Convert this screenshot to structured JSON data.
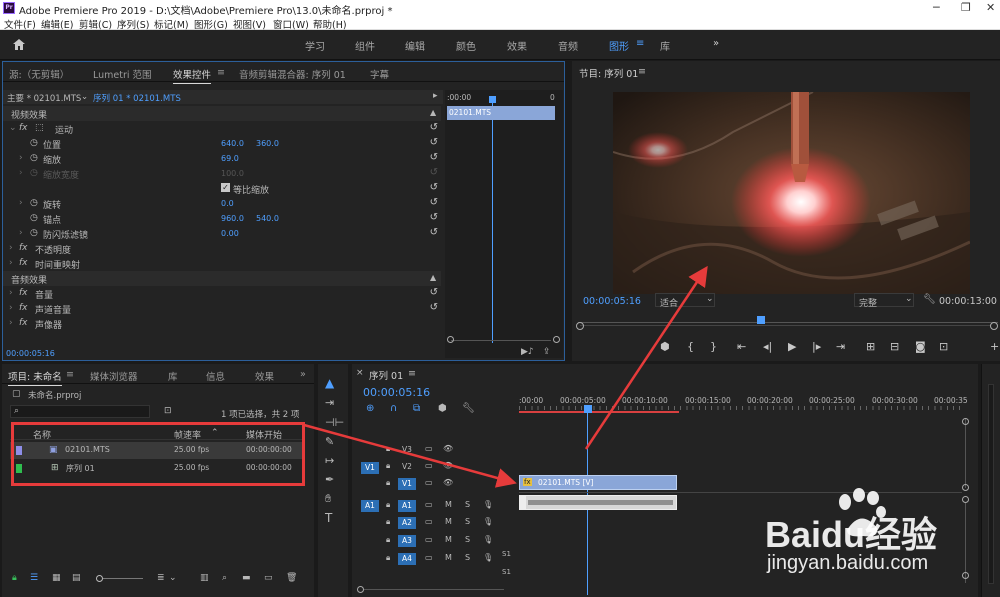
{
  "window": {
    "title": "Adobe Premiere Pro 2019 - D:\\文档\\Adobe\\Premiere Pro\\13.0\\未命名.prproj *",
    "app_icon": "Pr"
  },
  "menu": [
    "文件(F)",
    "编辑(E)",
    "剪辑(C)",
    "序列(S)",
    "标记(M)",
    "图形(G)",
    "视图(V)",
    "窗口(W)",
    "帮助(H)"
  ],
  "workspaces": [
    "学习",
    "组件",
    "编辑",
    "颜色",
    "效果",
    "音频",
    "图形",
    "库"
  ],
  "active_workspace": "图形",
  "effect_panel": {
    "tabs": [
      "源:（无剪辑）",
      "Lumetri 范围",
      "效果控件",
      "音频剪辑混合器: 序列 01",
      "字幕"
    ],
    "active_tab": "效果控件",
    "master": "主要 * 02101.MTS",
    "sequence": "序列 01 * 02101.MTS",
    "mini_time_start": ":00:00",
    "mini_time_end": "0",
    "clip_label": "02101.MTS",
    "video_effects": "视频效果",
    "motion": "运动",
    "position_label": "位置",
    "position_x": "640.0",
    "position_y": "360.0",
    "scale_label": "缩放",
    "scale": "69.0",
    "scale_width_label": "缩放宽度",
    "scale_width": "100.0",
    "uniform_scale": "等比缩放",
    "rotation_label": "旋转",
    "rotation": "0.0",
    "anchor_label": "锚点",
    "anchor_x": "960.0",
    "anchor_y": "540.0",
    "flicker_label": "防闪烁滤镜",
    "flicker": "0.00",
    "opacity": "不透明度",
    "time_remap": "时间重映射",
    "audio_effects": "音频效果",
    "volume": "音量",
    "channel_volume": "声道音量",
    "panner": "声像器",
    "timecode": "00:00:05:16"
  },
  "program": {
    "title": "节目: 序列 01",
    "timecode": "00:00:05:16",
    "fit": "适合",
    "quality": "完整",
    "duration": "00:00:13:00"
  },
  "project": {
    "tabs": [
      "项目: 未命名",
      "媒体浏览器",
      "库",
      "信息",
      "效果"
    ],
    "file": "未命名.prproj",
    "selection": "1 项已选择，共 2 项",
    "columns": [
      "名称",
      "帧速率",
      "媒体开始"
    ],
    "items": [
      {
        "name": "02101.MTS",
        "fps": "25.00 fps",
        "start": "00:00:00:00",
        "color": "#8e8ee8"
      },
      {
        "name": "序列 01",
        "fps": "25.00 fps",
        "start": "00:00:00:00",
        "color": "#2fbd4f"
      }
    ]
  },
  "timeline": {
    "tab": "序列 01",
    "timecode": "00:00:05:16",
    "ruler": [
      ":00:00",
      "00:00:05:00",
      "00:00:10:00",
      "00:00:15:00",
      "00:00:20:00",
      "00:00:25:00",
      "00:00:30:00",
      "00:00:35"
    ],
    "video_tracks": [
      "V3",
      "V2",
      "V1"
    ],
    "audio_tracks": [
      "A1",
      "A2",
      "A3",
      "A4"
    ],
    "source_v": "V1",
    "source_a": "A1",
    "clip_v": "02101.MTS [V]",
    "audio_meter": "S1"
  },
  "watermark": {
    "brand": "Baidu经验",
    "url": "jingyan.baidu.com"
  },
  "colors": {
    "accent": "#4f9fff",
    "track_on": "#2c6fb5",
    "clip": "#8aa6d8",
    "annotation": "#e63b3b"
  }
}
